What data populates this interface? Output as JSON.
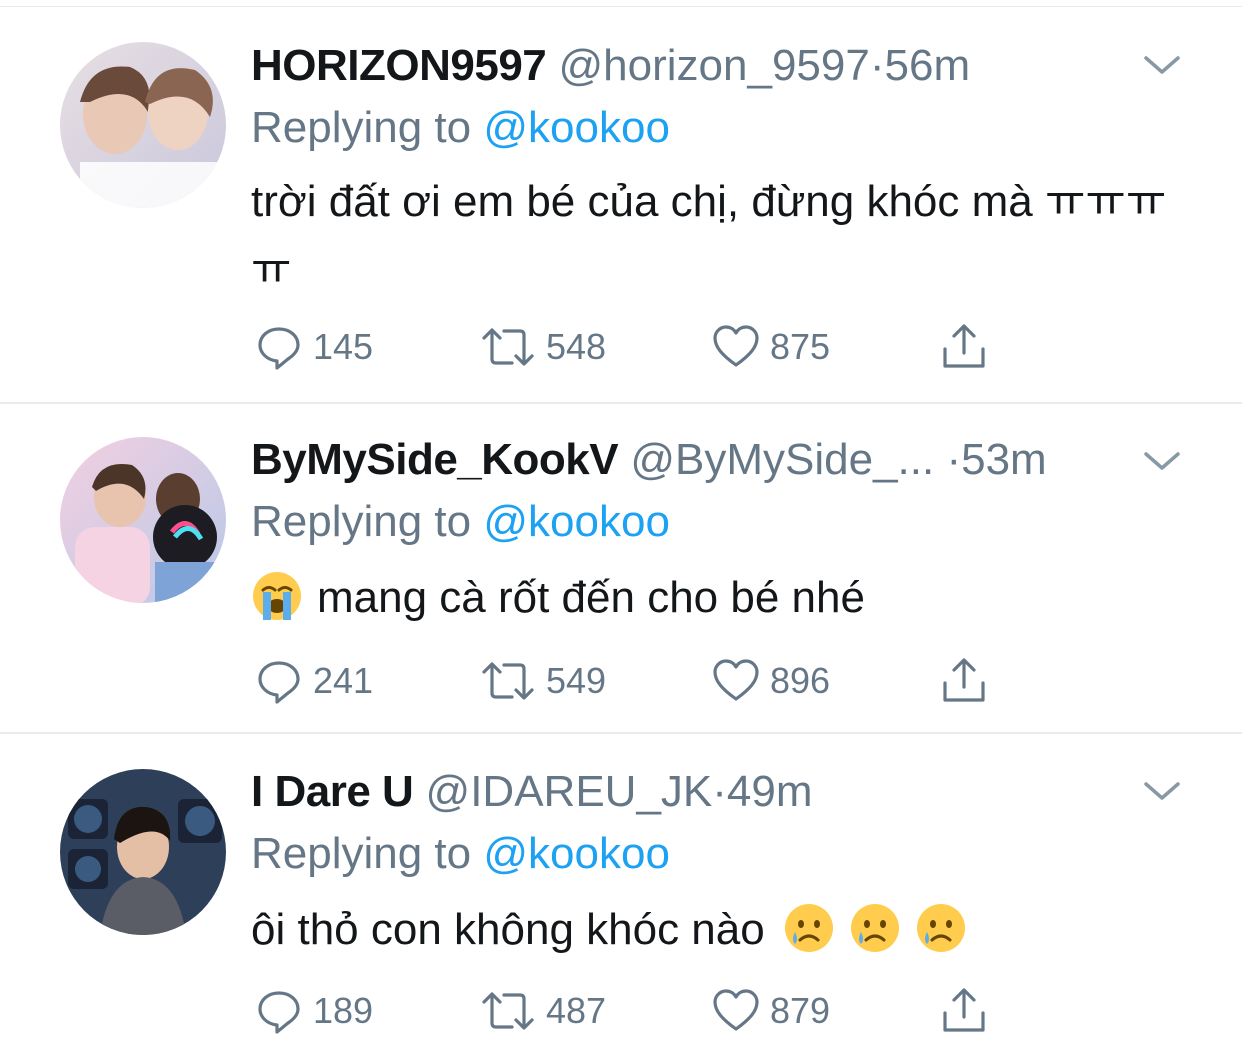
{
  "colors": {
    "accent": "#1da1f2",
    "secondary": "#657786",
    "primary": "#14171a",
    "divider": "#e6ecf0"
  },
  "tweets": [
    {
      "name": "HORIZON9597",
      "handle": "@horizon_9597",
      "dot": "·",
      "time": "56m",
      "reply_prefix": "Replying to",
      "reply_to": "@kookoo",
      "text": "trời đất ơi em bé của chị, đừng khóc mà ㅠㅠㅠㅠ",
      "emoji": [],
      "counts": {
        "reply": "145",
        "retweet": "548",
        "like": "875"
      },
      "avatar_icon": "profile-photo"
    },
    {
      "name": "ByMySide_KookV",
      "handle": "@ByMySide_...",
      "dot": "·",
      "time": "53m",
      "reply_prefix": "Replying to",
      "reply_to": "@kookoo",
      "text": "mang cà rốt đến cho bé nhé",
      "emoji": [
        "loudly-crying-face"
      ],
      "counts": {
        "reply": "241",
        "retweet": "549",
        "like": "896"
      },
      "avatar_icon": "profile-photo"
    },
    {
      "name": "I Dare U",
      "handle": "@IDAREU_JK",
      "dot": "·",
      "time": "49m",
      "reply_prefix": "Replying to",
      "reply_to": "@kookoo",
      "text": "ôi thỏ con không khóc nào",
      "emoji": [
        "crying-face",
        "crying-face",
        "crying-face"
      ],
      "counts": {
        "reply": "189",
        "retweet": "487",
        "like": "879"
      },
      "avatar_icon": "profile-photo"
    }
  ]
}
